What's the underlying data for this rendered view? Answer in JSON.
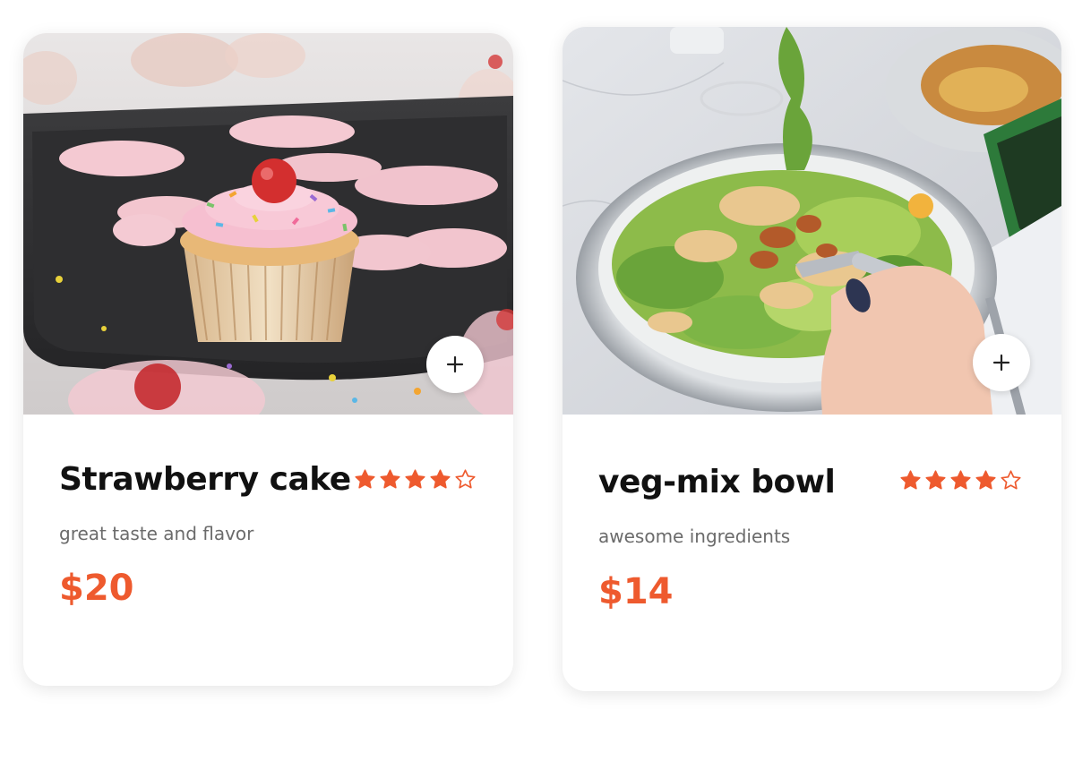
{
  "colors": {
    "accent": "#ee5a2e",
    "title": "#111111",
    "subtitle": "#6b6b6b",
    "card_bg": "#ffffff"
  },
  "products": [
    {
      "title": "Strawberry cake",
      "description": "great taste and flavor",
      "price": "$20",
      "rating": 4,
      "rating_max": 5,
      "image": "cupcake-photo",
      "add_icon": "plus-icon"
    },
    {
      "title": "veg-mix bowl",
      "description": "awesome ingredients",
      "price": "$14",
      "rating": 4,
      "rating_max": 5,
      "image": "salad-bowl-photo",
      "add_icon": "plus-icon"
    }
  ]
}
